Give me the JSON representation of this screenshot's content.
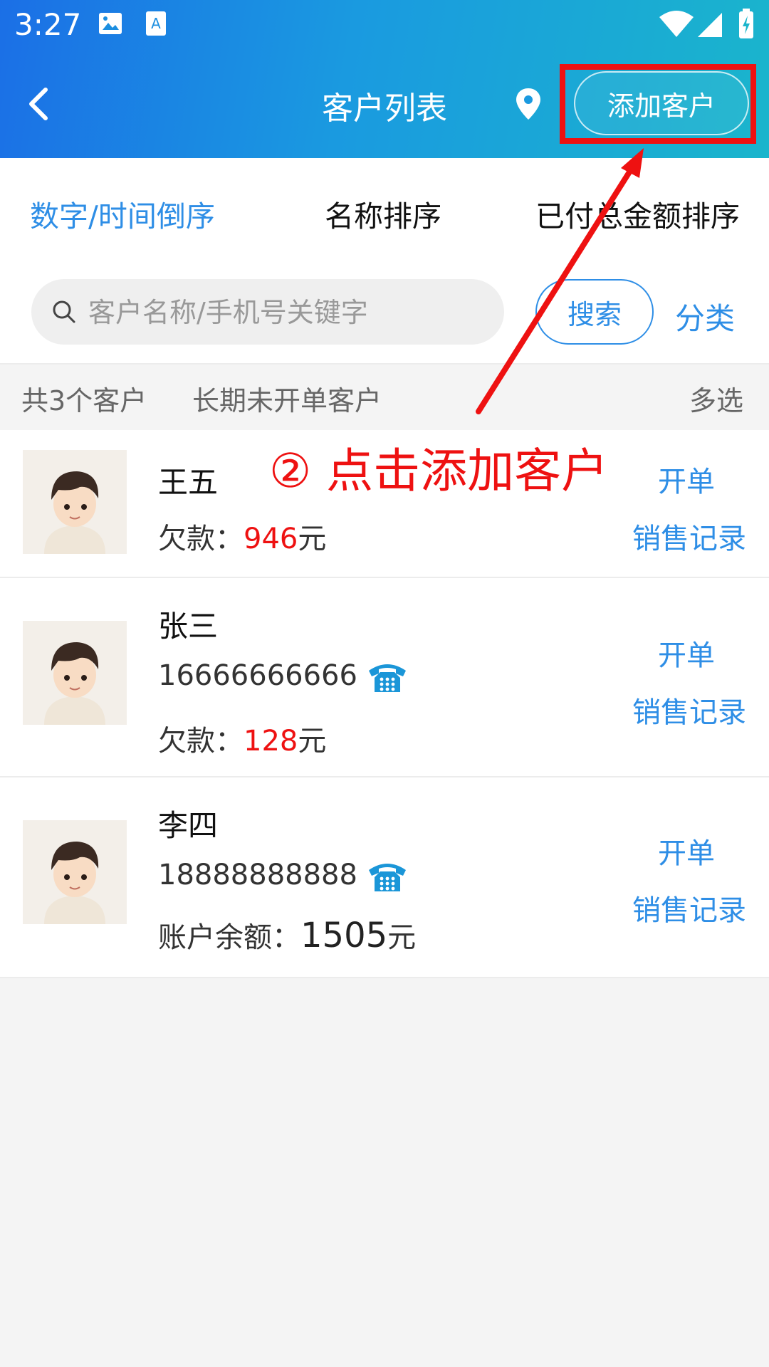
{
  "status_bar": {
    "time": "3:27"
  },
  "header": {
    "title": "客户列表",
    "add_button": "添加客户"
  },
  "sort_tabs": [
    {
      "label": "数字/时间倒序",
      "active": true
    },
    {
      "label": "名称排序",
      "active": false
    },
    {
      "label": "已付总金额排序",
      "active": false
    }
  ],
  "search": {
    "placeholder": "客户名称/手机号关键字",
    "button": "搜索",
    "category_button": "分类"
  },
  "filter": {
    "count_label": "共3个客户",
    "inactive_label": "长期未开单客户",
    "multi_select": "多选"
  },
  "customers": [
    {
      "name": "王五",
      "phone": "",
      "info_label": "欠款：",
      "info_value": "946",
      "info_unit": "元",
      "open_order": "开单",
      "sales_record": "销售记录"
    },
    {
      "name": "张三",
      "phone": "16666666666",
      "info_label": "欠款：",
      "info_value": "128",
      "info_unit": "元",
      "open_order": "开单",
      "sales_record": "销售记录"
    },
    {
      "name": "李四",
      "phone": "18888888888",
      "info_label": "账户余额：",
      "info_value": "1505",
      "info_unit": "元",
      "open_order": "开单",
      "sales_record": "销售记录"
    }
  ],
  "annotation": {
    "text": "② 点击添加客户"
  },
  "colors": {
    "accent": "#2e8ee6",
    "red": "#ee1111",
    "header_start": "#1b6fe6",
    "header_end": "#1ab5cc"
  }
}
